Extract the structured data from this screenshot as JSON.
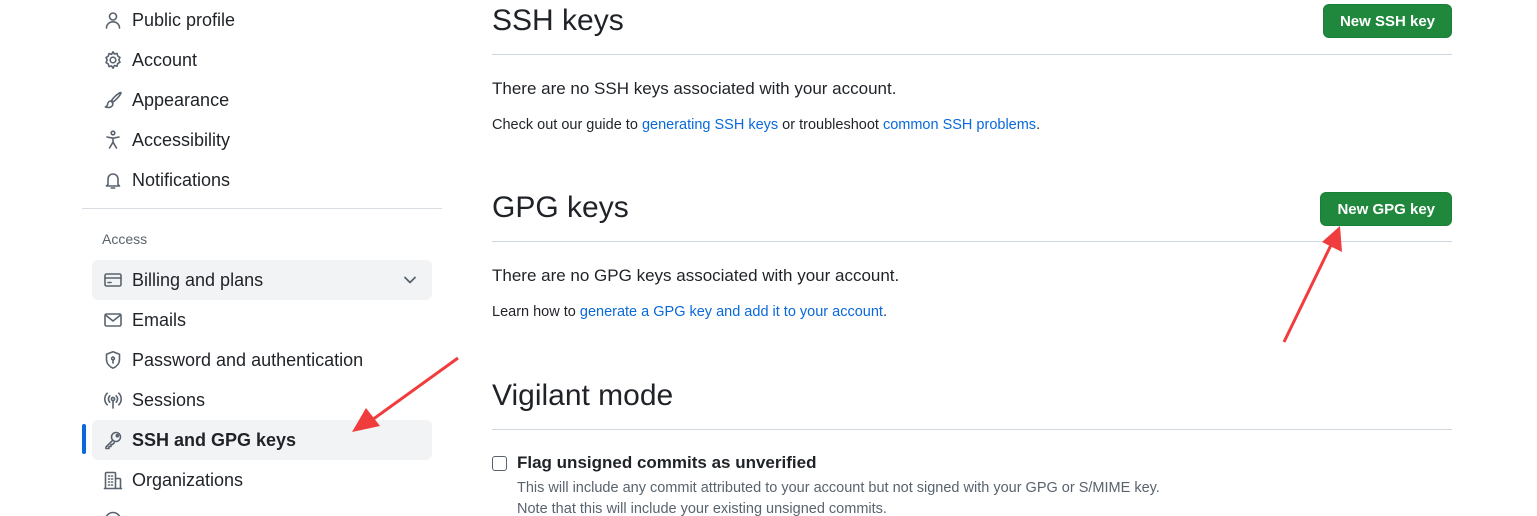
{
  "sidebar": {
    "items_top": [
      {
        "label": "Public profile",
        "icon": "person-icon"
      },
      {
        "label": "Account",
        "icon": "gear-icon"
      },
      {
        "label": "Appearance",
        "icon": "paintbrush-icon"
      },
      {
        "label": "Accessibility",
        "icon": "accessibility-icon"
      },
      {
        "label": "Notifications",
        "icon": "bell-icon"
      }
    ],
    "access_heading": "Access",
    "items_access": [
      {
        "label": "Billing and plans",
        "icon": "credit-card-icon"
      },
      {
        "label": "Emails",
        "icon": "mail-icon"
      },
      {
        "label": "Password and authentication",
        "icon": "shield-lock-icon"
      },
      {
        "label": "Sessions",
        "icon": "broadcast-icon"
      },
      {
        "label": "SSH and GPG keys",
        "icon": "key-icon"
      },
      {
        "label": "Organizations",
        "icon": "organization-icon"
      }
    ],
    "active_item": "SSH and GPG keys"
  },
  "ssh": {
    "title": "SSH keys",
    "button": "New SSH key",
    "empty_text": "There are no SSH keys associated with your account.",
    "guide_prefix": "Check out our guide to ",
    "guide_link1": "generating SSH keys",
    "guide_middle": " or troubleshoot ",
    "guide_link2": "common SSH problems",
    "guide_suffix": "."
  },
  "gpg": {
    "title": "GPG keys",
    "button": "New GPG key",
    "empty_text": "There are no GPG keys associated with your account.",
    "learn_prefix": "Learn how to ",
    "learn_link": "generate a GPG key and add it to your account",
    "learn_suffix": "."
  },
  "vigilant": {
    "title": "Vigilant mode",
    "checkbox_label": "Flag unsigned commits as unverified",
    "checkbox_checked": false,
    "desc1": "This will include any commit attributed to your account but not signed with your GPG or S/MIME key.",
    "desc2": "Note that this will include your existing unsigned commits."
  },
  "colors": {
    "accent": "#0969da",
    "button_green": "#1f883d",
    "annotation_red": "#f03c3c"
  }
}
